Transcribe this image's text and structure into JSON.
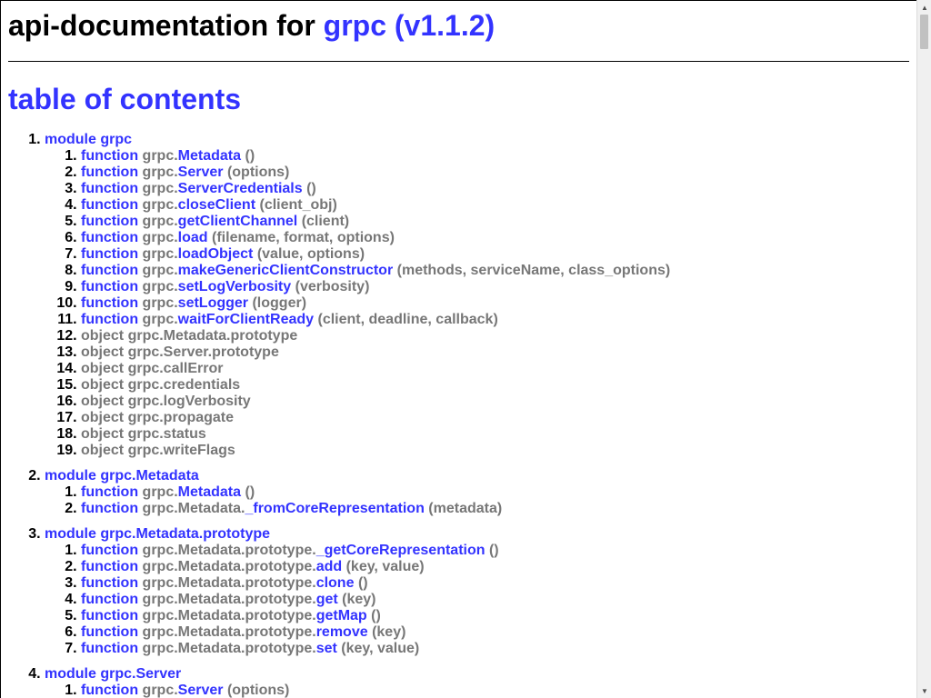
{
  "header": {
    "title_prefix": "api-documentation for ",
    "title_link": "grpc (v1.1.2)"
  },
  "toc": {
    "title": "table of contents",
    "modules": [
      {
        "label": "module grpc",
        "items": [
          {
            "kind": "function",
            "prefix": "grpc.",
            "name": "Metadata",
            "args": "()"
          },
          {
            "kind": "function",
            "prefix": "grpc.",
            "name": "Server",
            "args": "(options)"
          },
          {
            "kind": "function",
            "prefix": "grpc.",
            "name": "ServerCredentials",
            "args": "()"
          },
          {
            "kind": "function",
            "prefix": "grpc.",
            "name": "closeClient",
            "args": "(client_obj)"
          },
          {
            "kind": "function",
            "prefix": "grpc.",
            "name": "getClientChannel",
            "args": "(client)"
          },
          {
            "kind": "function",
            "prefix": "grpc.",
            "name": "load",
            "args": "(filename, format, options)"
          },
          {
            "kind": "function",
            "prefix": "grpc.",
            "name": "loadObject",
            "args": "(value, options)"
          },
          {
            "kind": "function",
            "prefix": "grpc.",
            "name": "makeGenericClientConstructor",
            "args": "(methods, serviceName, class_options)"
          },
          {
            "kind": "function",
            "prefix": "grpc.",
            "name": "setLogVerbosity",
            "args": "(verbosity)"
          },
          {
            "kind": "function",
            "prefix": "grpc.",
            "name": "setLogger",
            "args": "(logger)"
          },
          {
            "kind": "function",
            "prefix": "grpc.",
            "name": "waitForClientReady",
            "args": "(client, deadline, callback)"
          },
          {
            "kind": "object",
            "text": "object grpc.Metadata.prototype"
          },
          {
            "kind": "object",
            "text": "object grpc.Server.prototype"
          },
          {
            "kind": "object",
            "text": "object grpc.callError"
          },
          {
            "kind": "object",
            "text": "object grpc.credentials"
          },
          {
            "kind": "object",
            "text": "object grpc.logVerbosity"
          },
          {
            "kind": "object",
            "text": "object grpc.propagate"
          },
          {
            "kind": "object",
            "text": "object grpc.status"
          },
          {
            "kind": "object",
            "text": "object grpc.writeFlags"
          }
        ]
      },
      {
        "label": "module grpc.Metadata",
        "items": [
          {
            "kind": "function",
            "prefix": "grpc.",
            "name": "Metadata",
            "args": "()"
          },
          {
            "kind": "function",
            "prefix": "grpc.Metadata.",
            "name": "_fromCoreRepresentation",
            "args": "(metadata)"
          }
        ]
      },
      {
        "label": "module grpc.Metadata.prototype",
        "items": [
          {
            "kind": "function",
            "prefix": "grpc.Metadata.prototype.",
            "name": "_getCoreRepresentation",
            "args": "()"
          },
          {
            "kind": "function",
            "prefix": "grpc.Metadata.prototype.",
            "name": "add",
            "args": "(key, value)"
          },
          {
            "kind": "function",
            "prefix": "grpc.Metadata.prototype.",
            "name": "clone",
            "args": "()"
          },
          {
            "kind": "function",
            "prefix": "grpc.Metadata.prototype.",
            "name": "get",
            "args": "(key)"
          },
          {
            "kind": "function",
            "prefix": "grpc.Metadata.prototype.",
            "name": "getMap",
            "args": "()"
          },
          {
            "kind": "function",
            "prefix": "grpc.Metadata.prototype.",
            "name": "remove",
            "args": "(key)"
          },
          {
            "kind": "function",
            "prefix": "grpc.Metadata.prototype.",
            "name": "set",
            "args": "(key, value)"
          }
        ]
      },
      {
        "label": "module grpc.Server",
        "items": [
          {
            "kind": "function",
            "prefix": "grpc.",
            "name": "Server",
            "args": "(options)"
          }
        ]
      }
    ]
  },
  "scrollbar": {
    "up_icon": "triangle-up",
    "down_icon": "triangle-down"
  }
}
